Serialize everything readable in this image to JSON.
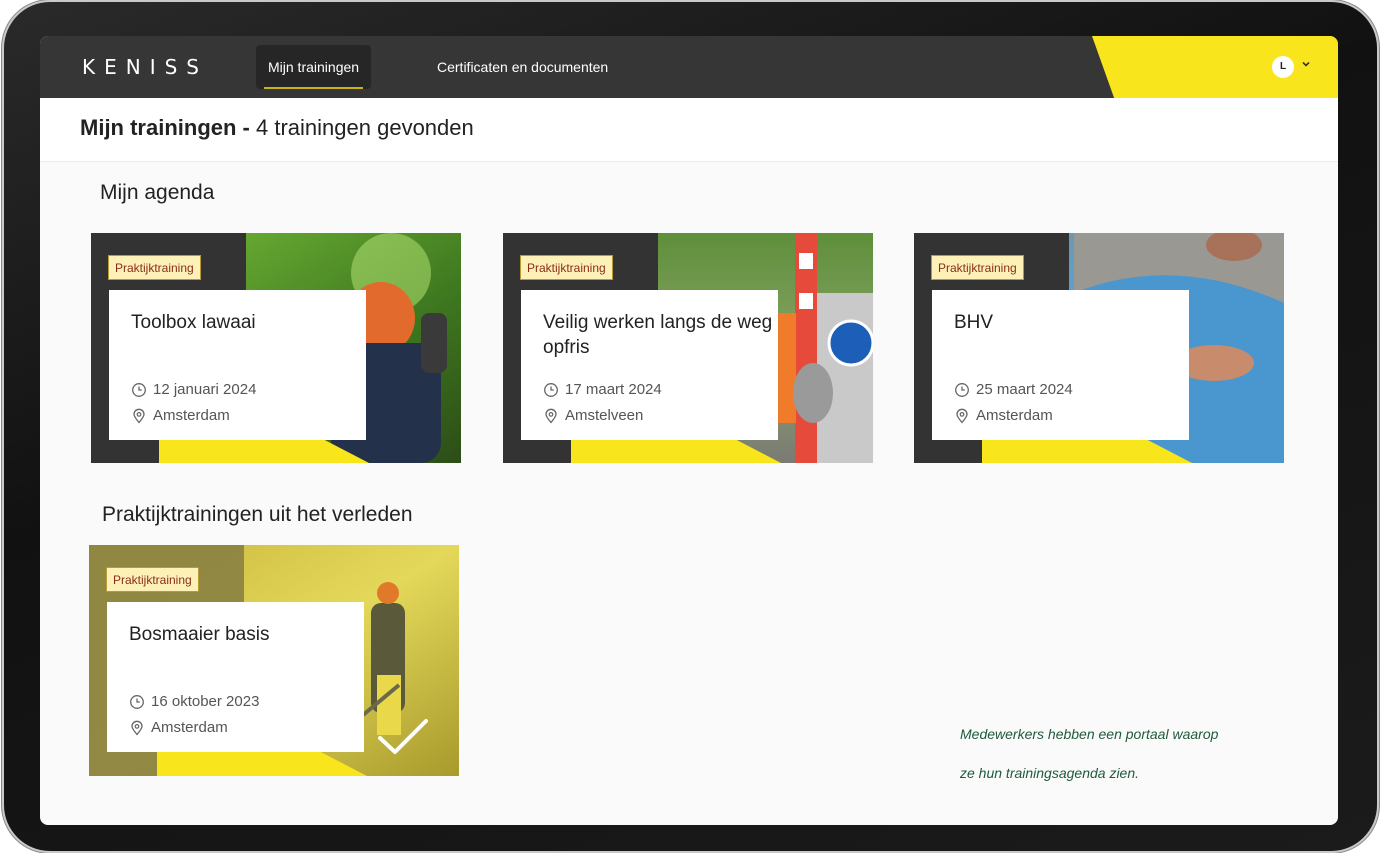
{
  "nav": {
    "logo": "KENISS",
    "items": [
      {
        "label": "Mijn trainingen",
        "active": true
      },
      {
        "label": "Certificaten en documenten",
        "active": false
      }
    ],
    "avatar_initial": "L"
  },
  "header": {
    "title_bold": "Mijn trainingen -",
    "title_rest": "4 trainingen gevonden"
  },
  "sections": {
    "agenda": "Mijn agenda",
    "past": "Praktijktrainingen uit het verleden"
  },
  "cards": [
    {
      "tag": "Praktijktraining",
      "title": "Toolbox lawaai",
      "date": "12 januari 2024",
      "location": "Amsterdam"
    },
    {
      "tag": "Praktijktraining",
      "title": "Veilig werken langs de weg opfris",
      "date": "17 maart 2024",
      "location": "Amstelveen"
    },
    {
      "tag": "Praktijktraining",
      "title": "BHV",
      "date": "25 maart 2024",
      "location": "Amsterdam"
    },
    {
      "tag": "Praktijktraining",
      "title": "Bosmaaier basis",
      "date": "16 oktober 2023",
      "location": "Amsterdam"
    }
  ],
  "caption": {
    "line1": "Medewerkers hebben een portaal waarop",
    "line2": "ze hun trainingsagenda zien."
  },
  "colors": {
    "brand_yellow": "#f9e51c",
    "topbar": "#363636",
    "tag_bg": "#fdf1b8",
    "tag_text": "#8a2e18",
    "caption": "#1f5a3c"
  }
}
